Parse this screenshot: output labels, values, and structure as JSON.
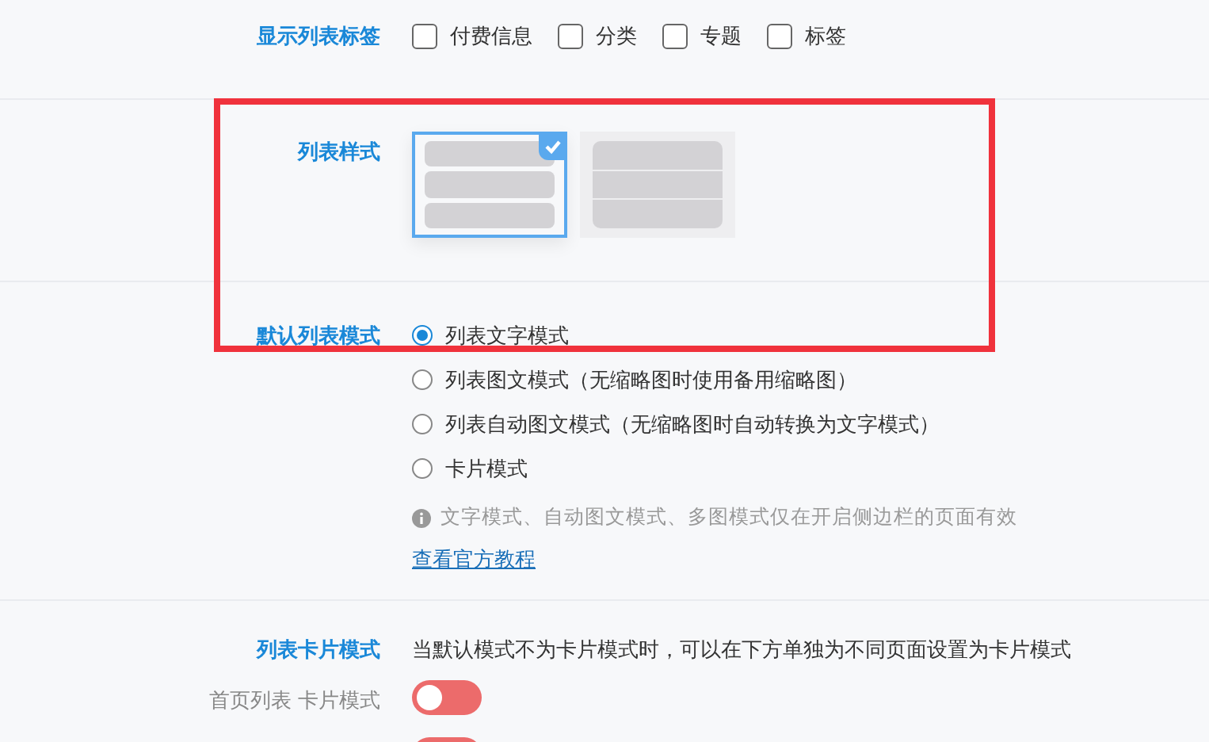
{
  "tag_row": {
    "label": "显示列表标签",
    "options": [
      {
        "label": "付费信息",
        "checked": false
      },
      {
        "label": "分类",
        "checked": false
      },
      {
        "label": "专题",
        "checked": false
      },
      {
        "label": "标签",
        "checked": false
      }
    ]
  },
  "list_style": {
    "label": "列表样式",
    "styles": [
      {
        "kind": "separate",
        "selected": true
      },
      {
        "kind": "joined",
        "selected": false
      }
    ]
  },
  "default_mode": {
    "label": "默认列表模式",
    "options": [
      {
        "label": "列表文字模式",
        "selected": true
      },
      {
        "label": "列表图文模式（无缩略图时使用备用缩略图）",
        "selected": false
      },
      {
        "label": "列表自动图文模式（无缩略图时自动转换为文字模式）",
        "selected": false
      },
      {
        "label": "卡片模式",
        "selected": false
      }
    ],
    "note": "文字模式、自动图文模式、多图模式仅在开启侧边栏的页面有效",
    "link": "查看官方教程"
  },
  "card_mode": {
    "label": "列表卡片模式",
    "description": "当默认模式不为卡片模式时，可以在下方单独为不同页面设置为卡片模式",
    "toggles": [
      {
        "label": "首页列表 卡片模式",
        "on": false
      },
      {
        "on": false
      }
    ]
  },
  "highlight_frame": true
}
